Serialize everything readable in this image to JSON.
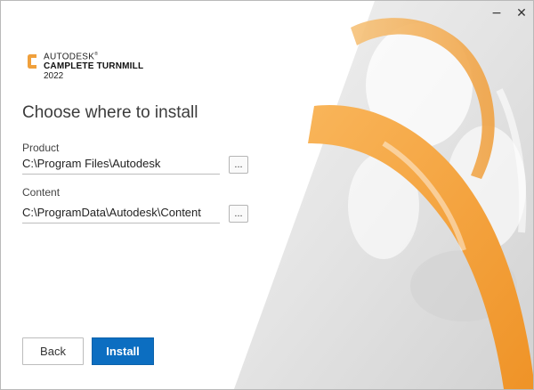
{
  "window": {
    "minimize_symbol": "−",
    "close_symbol": "✕"
  },
  "logo": {
    "brand": "AUTODESK",
    "trademark": "®",
    "product": "CAMPLETE TURNMILL",
    "year": "2022",
    "accent_color": "#f0a03c"
  },
  "heading": "Choose where to install",
  "fields": {
    "product": {
      "label": "Product",
      "value": "C:\\Program Files\\Autodesk",
      "browse_label": "..."
    },
    "content": {
      "label": "Content",
      "value": "C:\\ProgramData\\Autodesk\\Content",
      "browse_label": "..."
    }
  },
  "buttons": {
    "back": "Back",
    "install": "Install"
  },
  "colors": {
    "primary": "#0c6ec1",
    "orange": "#f4a33f"
  }
}
